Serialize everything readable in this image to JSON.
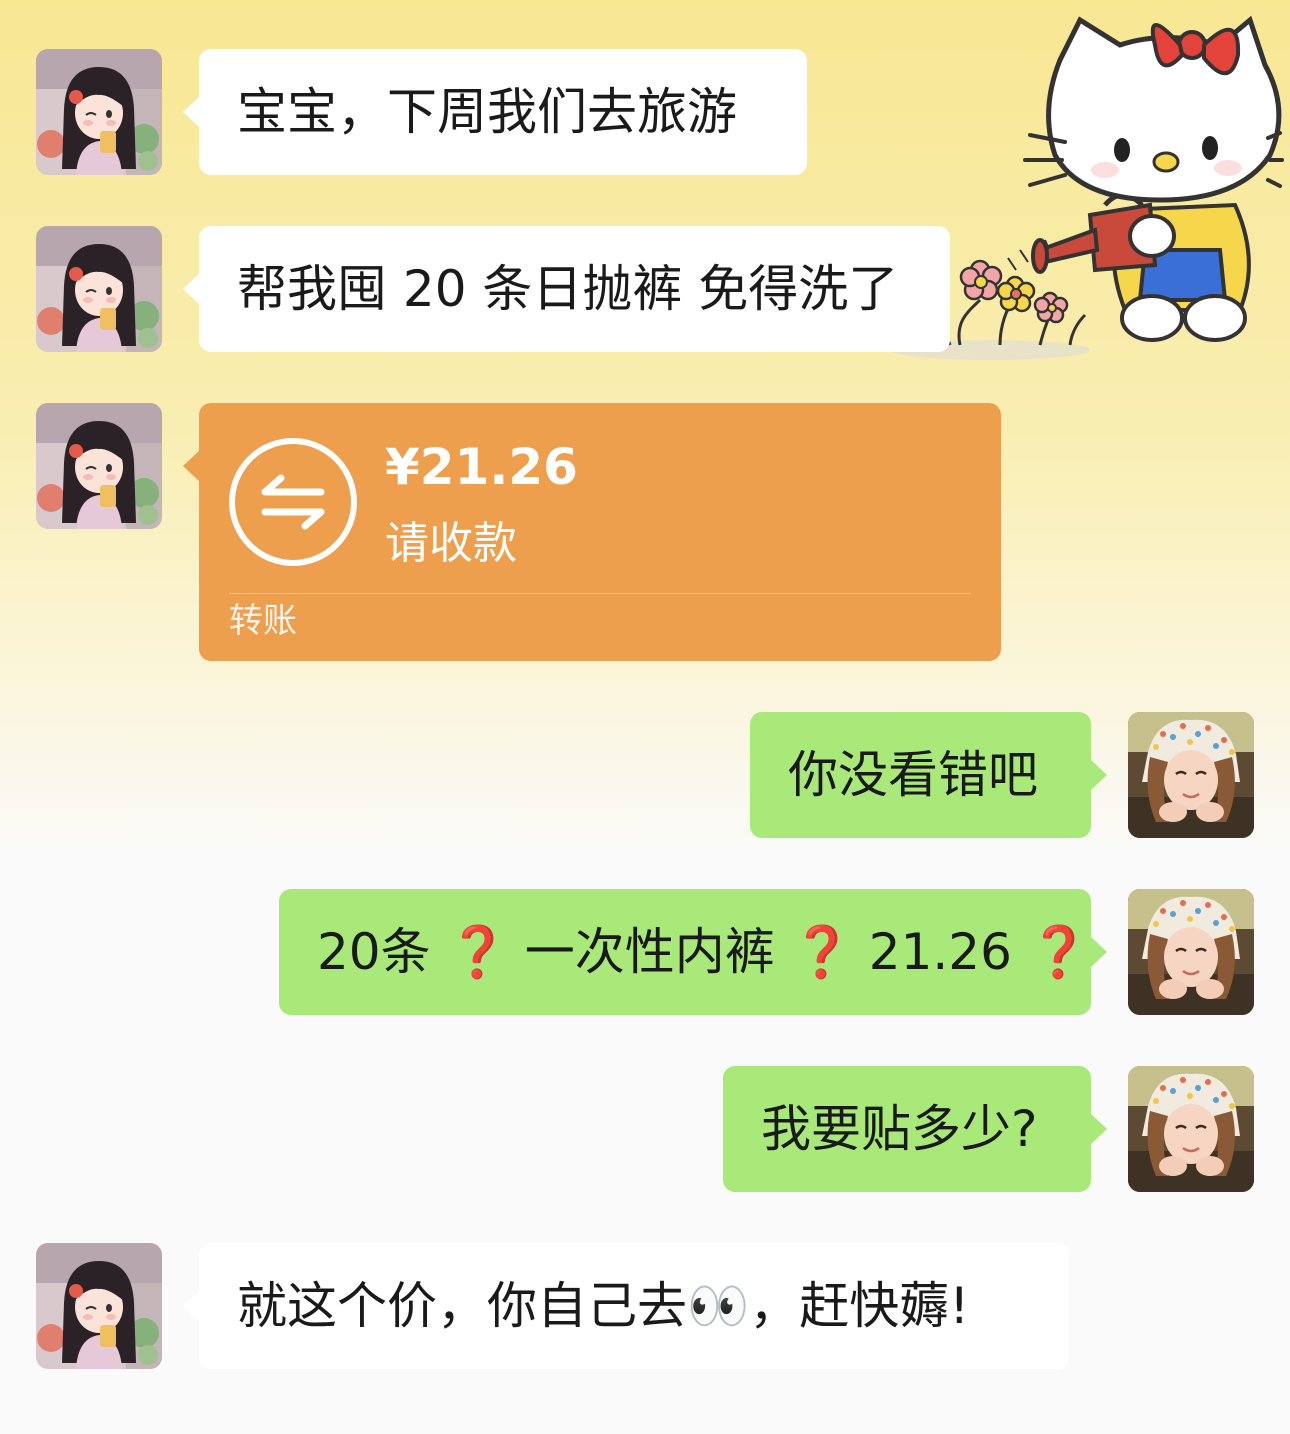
{
  "colors": {
    "incoming_bubble": "#ffffff",
    "outgoing_bubble": "#a9e97a",
    "transfer_card": "#ee9f4d",
    "question_mark": "#d42b2b"
  },
  "background_sticker": "hello-kitty-watering-flowers",
  "messages": [
    {
      "side": "left",
      "type": "text",
      "text": "宝宝，下周我们去旅游"
    },
    {
      "side": "left",
      "type": "text",
      "text": "帮我囤 20 条日抛裤 免得洗了"
    },
    {
      "side": "left",
      "type": "transfer",
      "amount": "¥21.26",
      "status": "请收款",
      "label": "转账",
      "icon": "transfer-arrows-icon"
    },
    {
      "side": "right",
      "type": "text",
      "text": "你没看错吧"
    },
    {
      "side": "right",
      "type": "text",
      "parts": [
        "20条",
        "❓",
        "一次性内裤",
        "❓",
        "21.26",
        "❓"
      ]
    },
    {
      "side": "right",
      "type": "text",
      "text": "我要贴多少?"
    },
    {
      "side": "left",
      "type": "text",
      "parts": [
        "就这个价，你自己去",
        "👀",
        "，赶快薅!"
      ]
    }
  ]
}
